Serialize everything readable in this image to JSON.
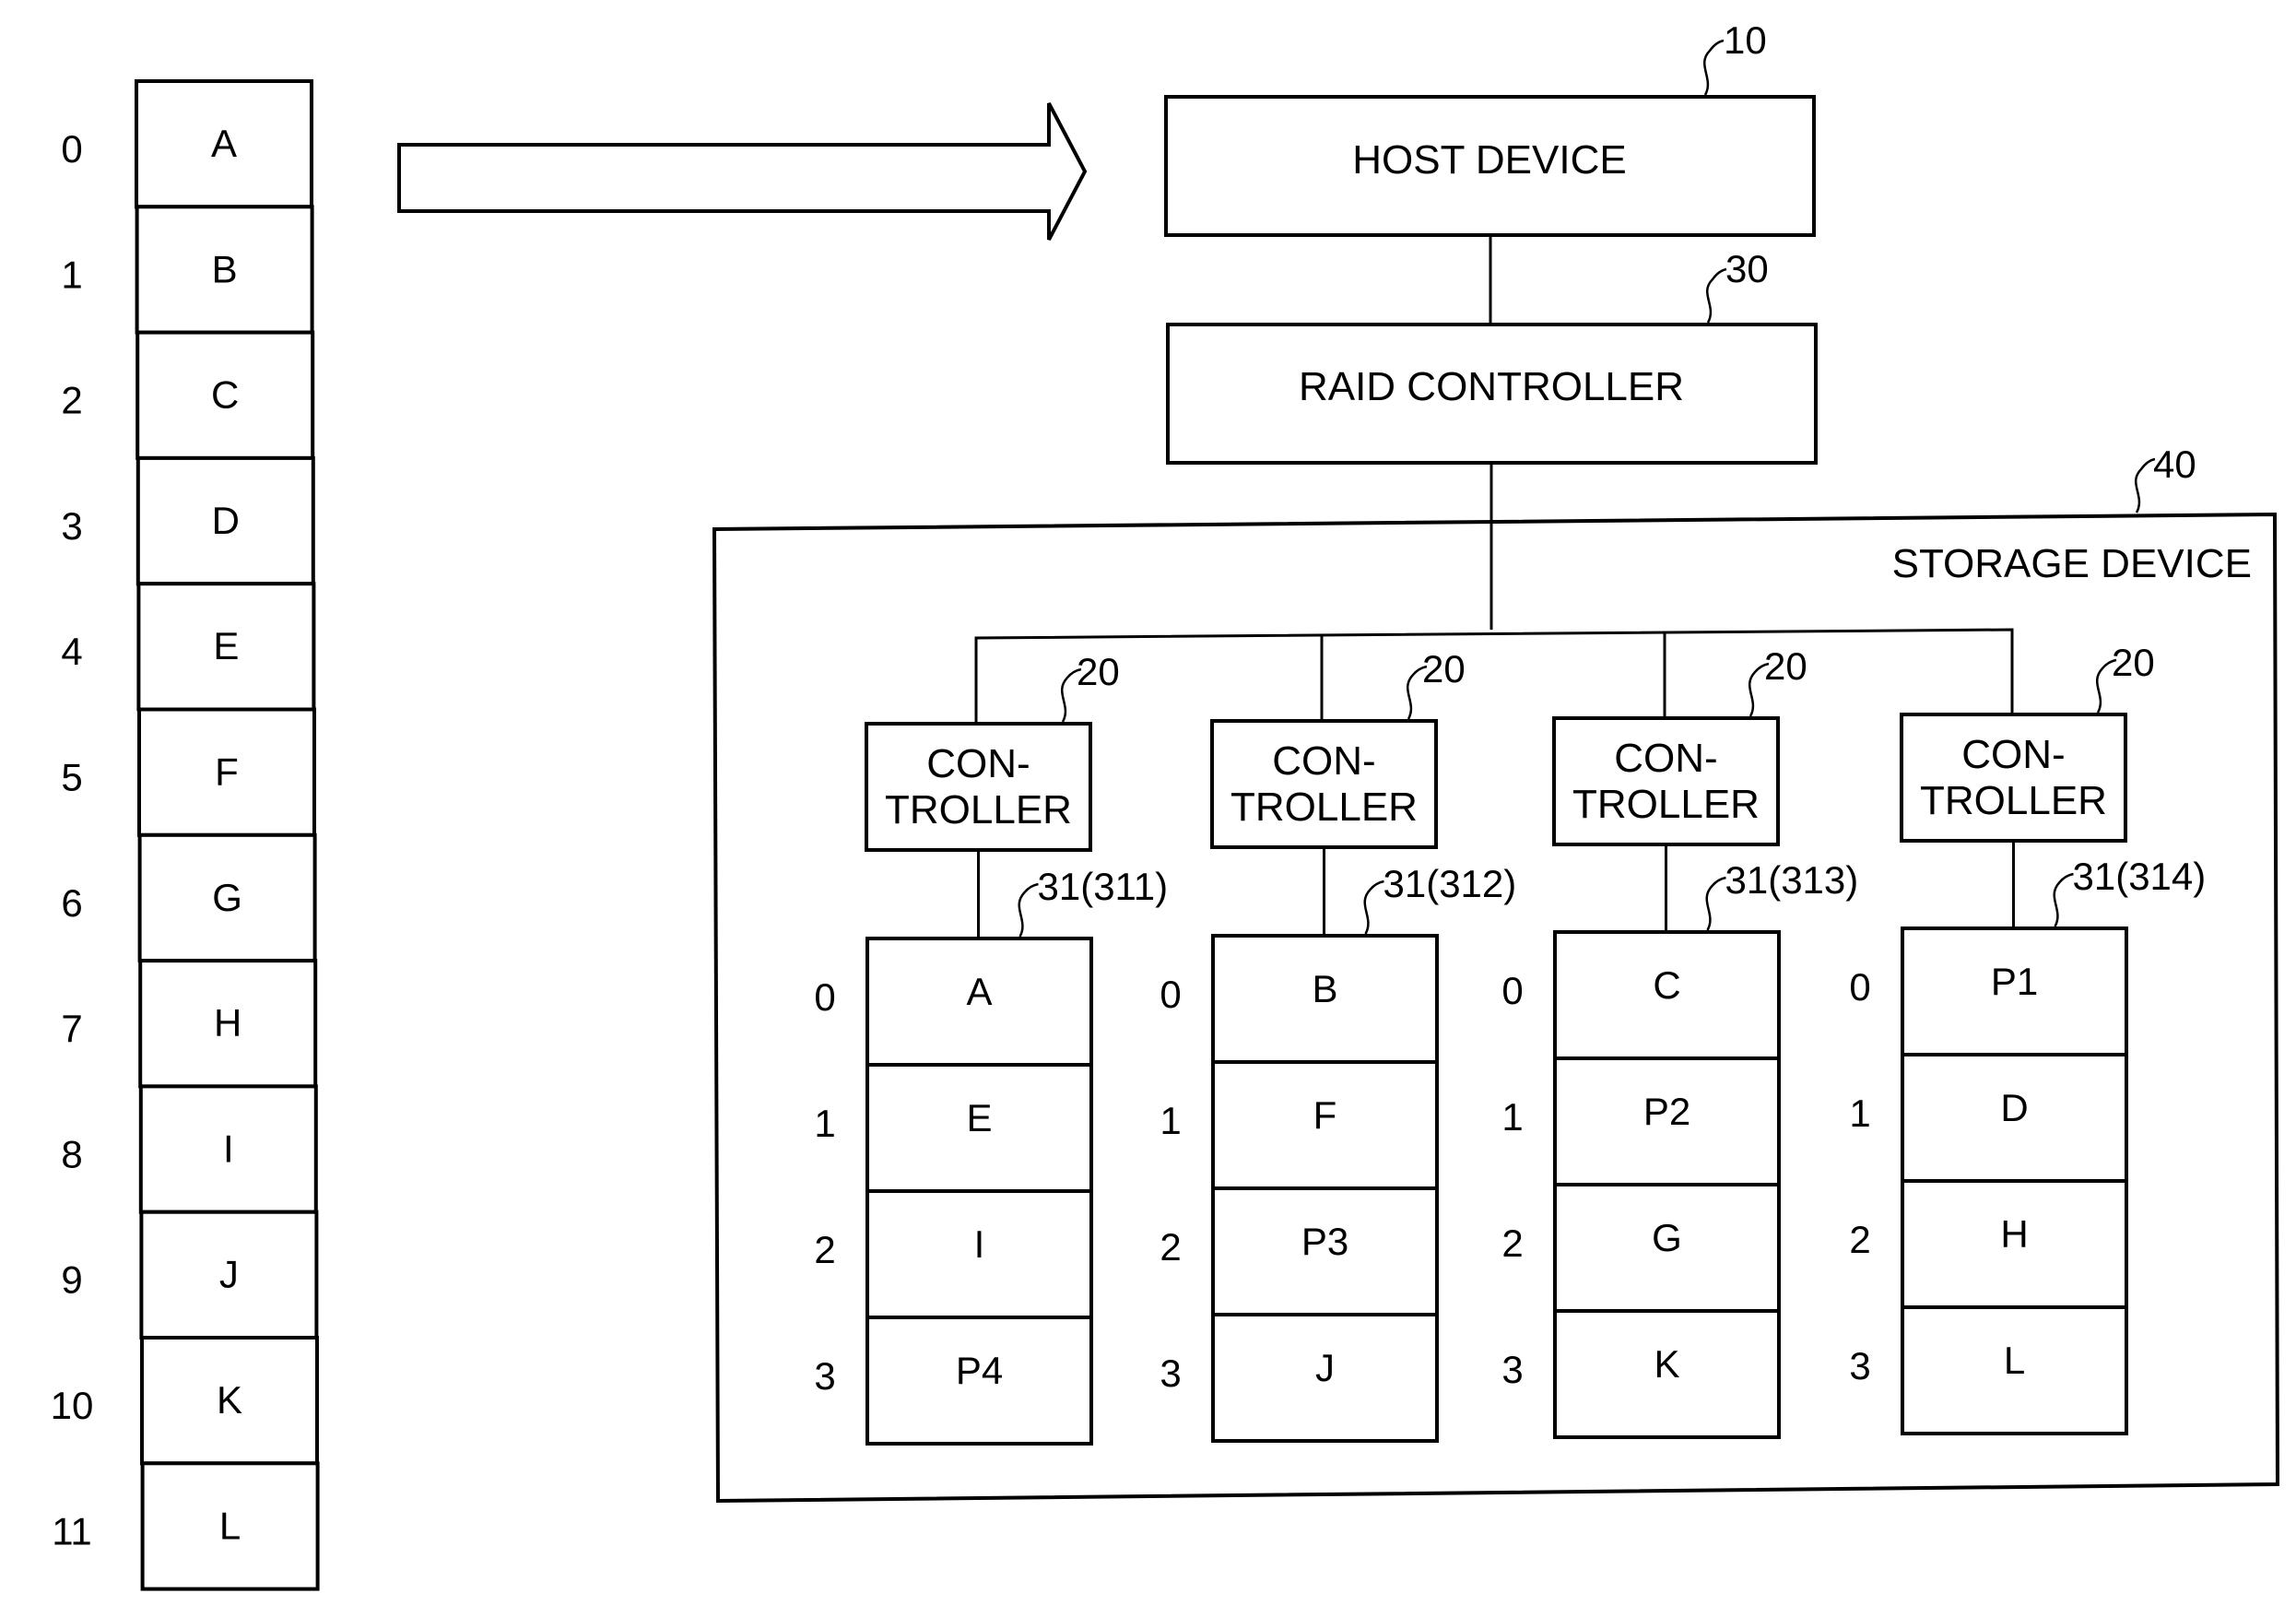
{
  "logical_volume": {
    "indices": [
      "0",
      "1",
      "2",
      "3",
      "4",
      "5",
      "6",
      "7",
      "8",
      "9",
      "10",
      "11"
    ],
    "blocks": [
      "A",
      "B",
      "C",
      "D",
      "E",
      "F",
      "G",
      "H",
      "I",
      "J",
      "K",
      "L"
    ]
  },
  "host_device": {
    "label": "HOST DEVICE",
    "ref": "10"
  },
  "raid_controller": {
    "label": "RAID CONTROLLER",
    "ref": "30"
  },
  "storage_device": {
    "label": "STORAGE DEVICE",
    "ref": "40"
  },
  "controllers": [
    {
      "line1": "CON-",
      "line2": "TROLLER",
      "ref": "20",
      "disk_ref": "31(311)",
      "stripe_indices": [
        "0",
        "1",
        "2",
        "3"
      ],
      "blocks": [
        "A",
        "E",
        "I",
        "P4"
      ]
    },
    {
      "line1": "CON-",
      "line2": "TROLLER",
      "ref": "20",
      "disk_ref": "31(312)",
      "stripe_indices": [
        "0",
        "1",
        "2",
        "3"
      ],
      "blocks": [
        "B",
        "F",
        "P3",
        "J"
      ]
    },
    {
      "line1": "CON-",
      "line2": "TROLLER",
      "ref": "20",
      "disk_ref": "31(313)",
      "stripe_indices": [
        "0",
        "1",
        "2",
        "3"
      ],
      "blocks": [
        "C",
        "P2",
        "G",
        "K"
      ]
    },
    {
      "line1": "CON-",
      "line2": "TROLLER",
      "ref": "20",
      "disk_ref": "31(314)",
      "stripe_indices": [
        "0",
        "1",
        "2",
        "3"
      ],
      "blocks": [
        "P1",
        "D",
        "H",
        "L"
      ]
    }
  ]
}
